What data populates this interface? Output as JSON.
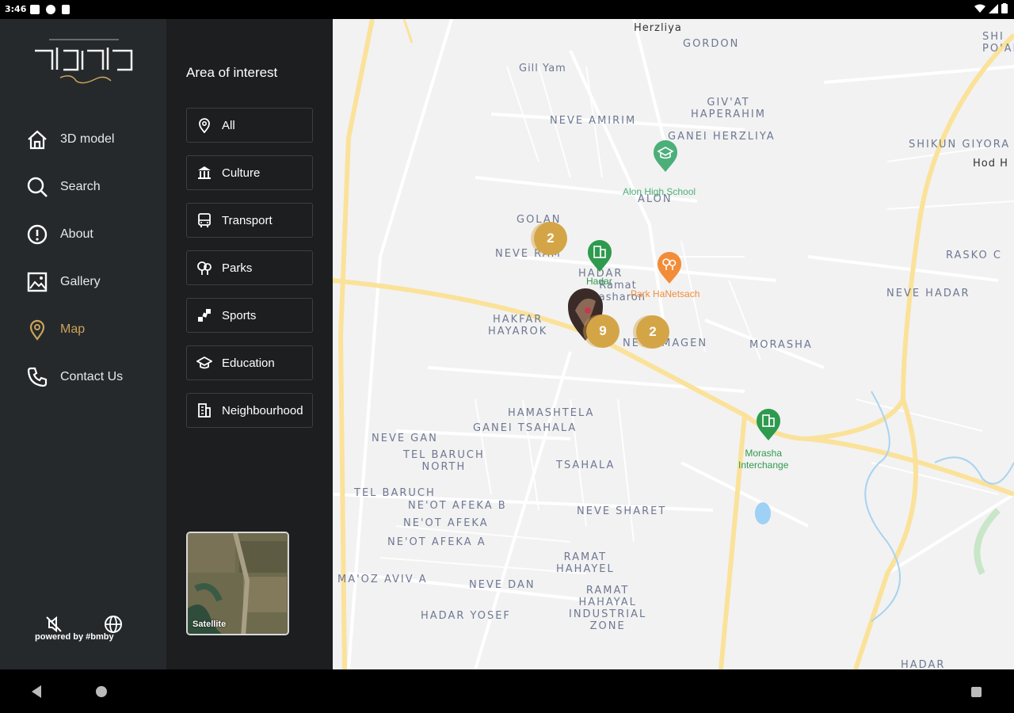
{
  "status_bar": {
    "time": "3:46"
  },
  "logo": {
    "alt": "פורטרט"
  },
  "sidebar": {
    "items": [
      {
        "label": "3D model",
        "icon": "home-icon"
      },
      {
        "label": "Search",
        "icon": "search-icon"
      },
      {
        "label": "About",
        "icon": "info-icon"
      },
      {
        "label": "Gallery",
        "icon": "gallery-icon"
      },
      {
        "label": "Map",
        "icon": "map-pin-icon",
        "active": true
      },
      {
        "label": "Contact Us",
        "icon": "phone-icon"
      }
    ],
    "powered_by": "powered by #bmby",
    "accent_color": "#c9a45a"
  },
  "panel": {
    "title": "Area of interest",
    "filters": [
      {
        "label": "All",
        "icon": "pin-icon"
      },
      {
        "label": "Culture",
        "icon": "museum-icon"
      },
      {
        "label": "Transport",
        "icon": "bus-icon"
      },
      {
        "label": "Parks",
        "icon": "tree-icon"
      },
      {
        "label": "Sports",
        "icon": "sports-icon"
      },
      {
        "label": "Education",
        "icon": "graduation-cap-icon"
      },
      {
        "label": "Neighbourhood",
        "icon": "building-icon"
      }
    ],
    "satellite_label": "Satellite"
  },
  "map": {
    "areas": [
      {
        "text": "Herzliya"
      },
      {
        "text": "GORDON"
      },
      {
        "text": "Gill Yam"
      },
      {
        "text": "GIV'AT\nHAPERAHIM"
      },
      {
        "text": "NEVE AMIRIM"
      },
      {
        "text": "GANEI HERZLIYA"
      },
      {
        "text": "SHIKUN GIYORA"
      },
      {
        "text": "Hod H"
      },
      {
        "text": "SHI\nPO'AL"
      },
      {
        "text": "ALON"
      },
      {
        "text": "GOLAN"
      },
      {
        "text": "NEVE RAM"
      },
      {
        "text": "HADAR"
      },
      {
        "text": "Ramat\nHasharon"
      },
      {
        "text": "RASKO C"
      },
      {
        "text": "NEVE HADAR"
      },
      {
        "text": "HAKFAR\nHAYAROK"
      },
      {
        "text": "NEVE MAGEN"
      },
      {
        "text": "MORASHA"
      },
      {
        "text": "HAMASHTELA"
      },
      {
        "text": "GANEI TSAHALA"
      },
      {
        "text": "NEVE GAN"
      },
      {
        "text": "TEL BARUCH\nNORTH"
      },
      {
        "text": "TSAHALA"
      },
      {
        "text": "TEL BARUCH"
      },
      {
        "text": "NE'OT AFEKA B"
      },
      {
        "text": "NE'OT AFEKA"
      },
      {
        "text": "NE'OT AFEKA A"
      },
      {
        "text": "NEVE SHARET"
      },
      {
        "text": "RAMAT\nHAHAYEL"
      },
      {
        "text": "MA'OZ AVIV A"
      },
      {
        "text": "NEVE DAN"
      },
      {
        "text": "RAMAT\nHAHAYAL\nINDUSTRIAL\nZONE"
      },
      {
        "text": "HADAR YOSEF"
      },
      {
        "text": "HADAR"
      }
    ],
    "pois": [
      {
        "label": "Alon High School",
        "color": "#4caf7a",
        "icon": "graduation-cap-icon"
      },
      {
        "label": "Hadar",
        "color": "#2e9a4e",
        "icon": "building-icon"
      },
      {
        "label": "Park HaNetsach",
        "color": "#f28c38",
        "icon": "tree-icon"
      },
      {
        "label": "Morasha\nInterchange",
        "color": "#2e9a4e",
        "icon": "building-icon"
      }
    ],
    "clusters": [
      {
        "count": "2"
      },
      {
        "count": "9"
      },
      {
        "count": "2"
      }
    ],
    "cluster_color": "#d4a547",
    "land_color": "#f2f2f2",
    "road_color": "#fbe29a"
  }
}
